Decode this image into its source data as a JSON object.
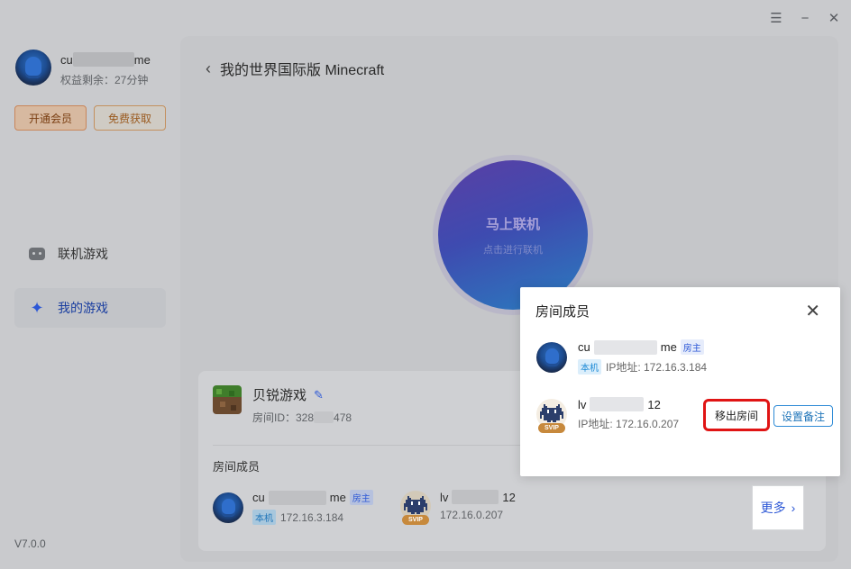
{
  "window": {
    "menu_icon": "☰",
    "min_icon": "−",
    "close_icon": "✕"
  },
  "user": {
    "name_prefix": "cu",
    "name_suffix": "me",
    "benefit": "权益剩余：27分钟"
  },
  "sidebar": {
    "vip_button": "开通会员",
    "free_button": "免费获取",
    "items": [
      {
        "label": "联机游戏"
      },
      {
        "label": "我的游戏"
      }
    ],
    "version": "V7.0.0"
  },
  "main": {
    "back_title": "我的世界国际版 Minecraft",
    "connect": {
      "title": "马上联机",
      "subtitle": "点击进行联机"
    },
    "game": {
      "name": "贝锐游戏",
      "room_id_prefix": "房间ID：328",
      "room_id_suffix": "478"
    },
    "members_label": "房间成员",
    "members": [
      {
        "name_prefix": "cu",
        "name_suffix": "me",
        "tag_host": "房主",
        "tag_local": "本机",
        "ip": "172.16.3.184"
      },
      {
        "name_prefix": "lv",
        "name_suffix": "12",
        "ip": "172.16.0.207",
        "badge": "SVIP"
      }
    ],
    "more_button": "更多"
  },
  "popup": {
    "title": "房间成员",
    "members": [
      {
        "name_prefix": "cu",
        "name_suffix": "me",
        "tag_host": "房主",
        "tag_local": "本机",
        "ip_label": "IP地址: 172.16.3.184"
      },
      {
        "name_prefix": "lv",
        "name_suffix": "12",
        "ip_label": "IP地址: 172.16.0.207",
        "badge": "SVIP"
      }
    ],
    "kick_button": "移出房间",
    "note_button": "设置备注"
  }
}
